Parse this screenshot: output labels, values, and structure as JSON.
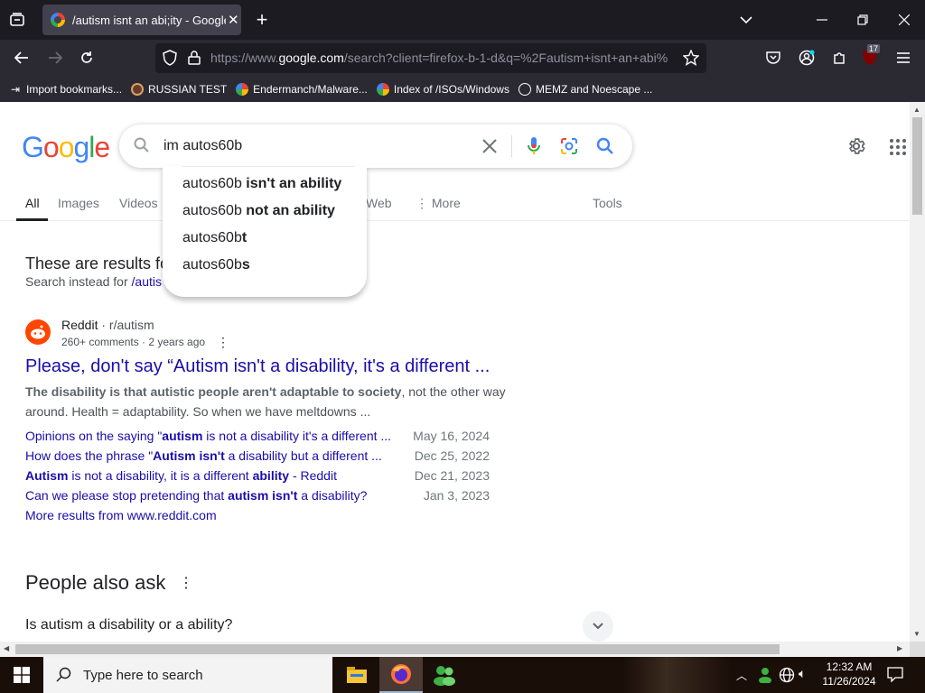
{
  "browser": {
    "tab_title": "/autism isnt an abi;ity - Google",
    "url_prefix": "https://www.",
    "url_domain": "google.com",
    "url_rest": "/search?client=firefox-b-1-d&q=%2Fautism+isnt+an+abi%",
    "extensions_badge": "17",
    "bookmarks": [
      {
        "label": "Import bookmarks..."
      },
      {
        "label": "RUSSIAN TEST"
      },
      {
        "label": "Endermanch/Malware..."
      },
      {
        "label": "Index of /ISOs/Windows"
      },
      {
        "label": "MEMZ and Noescape ..."
      }
    ]
  },
  "google": {
    "logo_letters": [
      "G",
      "o",
      "o",
      "g",
      "l",
      "e"
    ],
    "logo_colors": [
      "#4285f4",
      "#ea4335",
      "#fbbc05",
      "#4285f4",
      "#34a853",
      "#ea4335"
    ],
    "query": "im autos60b",
    "suggestions": [
      {
        "prefix": "autos60b ",
        "bold": "isn't an ability"
      },
      {
        "prefix": "autos60b ",
        "bold": "not an ability"
      },
      {
        "prefix": "autos60b",
        "bold": "t"
      },
      {
        "prefix": "autos60b",
        "bold": "s"
      }
    ],
    "tabs": [
      {
        "label": "All"
      },
      {
        "label": "Images"
      },
      {
        "label": "Videos"
      },
      {
        "label": "Web"
      },
      {
        "label": "More"
      },
      {
        "label": "Tools"
      }
    ],
    "correction_heading": "These are results fo",
    "correction_instead": "Search instead for ",
    "correction_link": "/autis",
    "result": {
      "site": "Reddit",
      "path": " · r/autism",
      "meta": "260+ comments · 2 years ago",
      "title": "Please, don't say “Autism isn't a disability, it's a different ...",
      "snippet_bold": "The disability is that autistic people aren't adaptable to society",
      "snippet_rest": ", not the other way",
      "snippet_line2": "around. Health = adaptability. So when we have meltdowns ...",
      "sublinks": [
        {
          "parts": [
            [
              "Opinions on the saying \"",
              false
            ],
            [
              "autism",
              true
            ],
            [
              " is not a disability it's a different ...",
              false
            ]
          ],
          "date": "May 16, 2024"
        },
        {
          "parts": [
            [
              "How does the phrase \"",
              false
            ],
            [
              "Autism isn't",
              true
            ],
            [
              " a disability but a different ...",
              false
            ]
          ],
          "date": "Dec 25, 2022"
        },
        {
          "parts": [
            [
              "Autism",
              true
            ],
            [
              " is not a disability, it is a different ",
              false
            ],
            [
              "ability",
              true
            ],
            [
              " - Reddit",
              false
            ]
          ],
          "date": "Dec 21, 2023"
        },
        {
          "parts": [
            [
              "Can we please stop pretending that ",
              false
            ],
            [
              "autism isn't",
              true
            ],
            [
              " a disability?",
              false
            ]
          ],
          "date": "Jan 3, 2023"
        }
      ],
      "more_results": "More results from www.reddit.com"
    },
    "paa_heading": "People also ask",
    "paa_question": "Is autism a disability or a ability?"
  },
  "taskbar": {
    "search_placeholder": "Type here to search",
    "time": "12:32 AM",
    "date": "11/26/2024"
  }
}
